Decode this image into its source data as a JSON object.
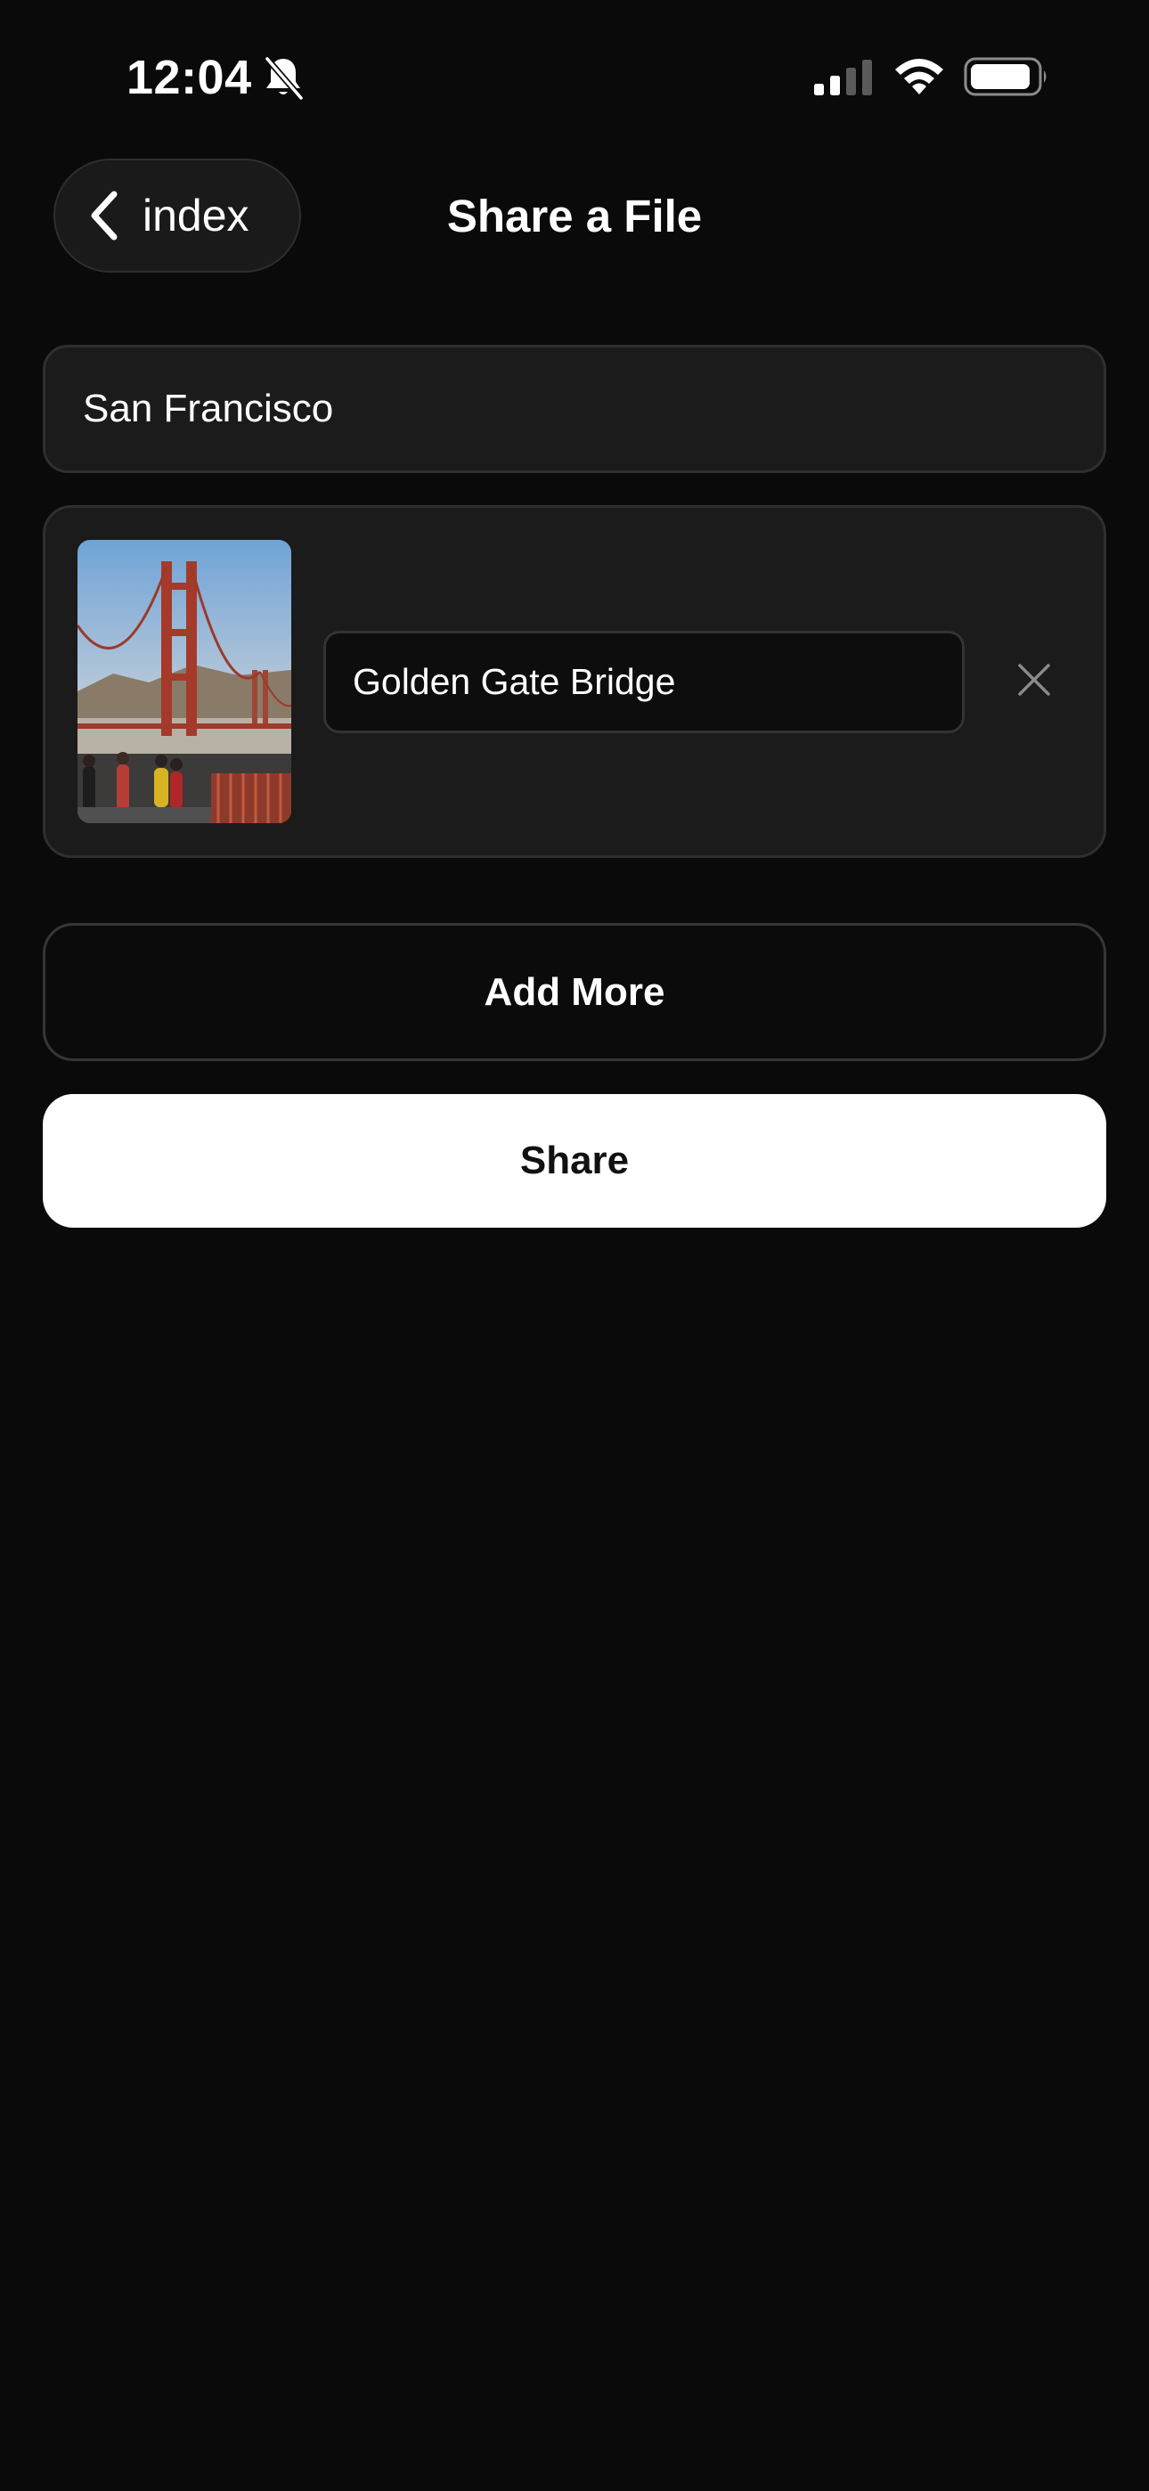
{
  "status_bar": {
    "time": "12:04",
    "icons": [
      "bell-slash-icon",
      "cellular-signal-icon",
      "wifi-icon",
      "battery-icon"
    ]
  },
  "nav": {
    "back_label": "index",
    "title": "Share a File"
  },
  "form": {
    "title_value": "San Francisco",
    "files": [
      {
        "thumbnail": "golden-gate-bridge-photo",
        "caption_value": "Golden Gate Bridge"
      }
    ],
    "add_more_label": "Add More",
    "share_label": "Share"
  },
  "colors": {
    "background": "#0a0a0a",
    "card": "#1b1b1b",
    "border": "#2f2f2f",
    "primary_button": "#ffffff",
    "primary_button_text": "#111111"
  }
}
